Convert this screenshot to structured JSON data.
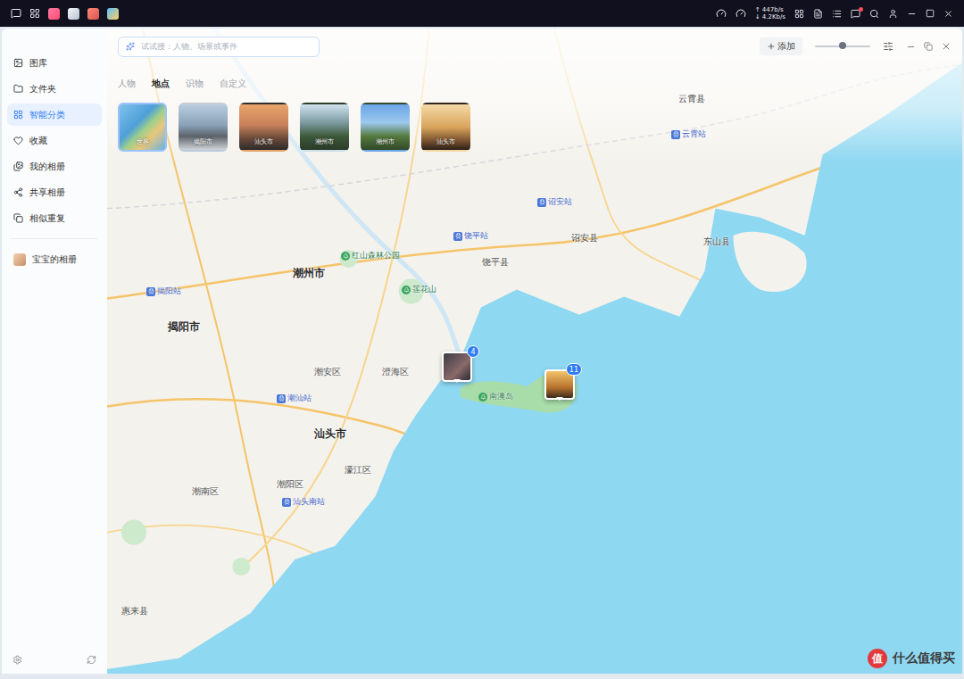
{
  "taskbar": {
    "net_up": "↑ 447b/s",
    "net_down": "↓ 4.2Kb/s"
  },
  "sidebar": {
    "items": [
      {
        "label": "图库",
        "selected": false
      },
      {
        "label": "文件夹",
        "selected": false
      },
      {
        "label": "智能分类",
        "selected": true
      },
      {
        "label": "收藏",
        "selected": false
      },
      {
        "label": "我的相册",
        "selected": false
      },
      {
        "label": "共享相册",
        "selected": false
      },
      {
        "label": "相似重复",
        "selected": false
      }
    ],
    "albums": [
      {
        "label": "宝宝的相册",
        "selected": false
      }
    ]
  },
  "search": {
    "placeholder": "试试搜：人物、场景或事件"
  },
  "toolbar": {
    "add_label": "添加",
    "zoom_level": 0.5
  },
  "tabs": [
    {
      "label": "人物",
      "selected": false
    },
    {
      "label": "地点",
      "selected": true
    },
    {
      "label": "识物",
      "selected": false
    },
    {
      "label": "自定义",
      "selected": false
    }
  ],
  "places": [
    {
      "label": "世界",
      "selected": true
    },
    {
      "label": "揭阳市",
      "selected": false
    },
    {
      "label": "汕头市",
      "selected": false
    },
    {
      "label": "潮州市",
      "selected": false
    },
    {
      "label": "潮州市",
      "selected": false
    },
    {
      "label": "汕头市",
      "selected": false
    }
  ],
  "map": {
    "labels": [
      {
        "text": "潮州市",
        "kind": "city"
      },
      {
        "text": "揭阳市",
        "kind": "city"
      },
      {
        "text": "汕头市",
        "kind": "city"
      },
      {
        "text": "饶平县",
        "kind": "county"
      },
      {
        "text": "诏安县",
        "kind": "county"
      },
      {
        "text": "东山县",
        "kind": "county"
      },
      {
        "text": "云霄县",
        "kind": "county"
      },
      {
        "text": "潮安区",
        "kind": "county"
      },
      {
        "text": "澄海区",
        "kind": "county"
      },
      {
        "text": "濠江区",
        "kind": "county"
      },
      {
        "text": "潮阳区",
        "kind": "county"
      },
      {
        "text": "潮南区",
        "kind": "county"
      },
      {
        "text": "惠来县",
        "kind": "county"
      },
      {
        "text": "饶平站",
        "kind": "station"
      },
      {
        "text": "诏安站",
        "kind": "station"
      },
      {
        "text": "云霄站",
        "kind": "station"
      },
      {
        "text": "揭阳站",
        "kind": "station"
      },
      {
        "text": "潮汕站",
        "kind": "station"
      },
      {
        "text": "汕头南站",
        "kind": "station"
      },
      {
        "text": "红山森林公园",
        "kind": "park"
      },
      {
        "text": "莲花山",
        "kind": "park"
      },
      {
        "text": "南澳岛",
        "kind": "park"
      }
    ],
    "pins": [
      {
        "count": "4"
      },
      {
        "count": "11"
      }
    ]
  },
  "watermark": {
    "logo": "值",
    "text": "什么值得买"
  }
}
